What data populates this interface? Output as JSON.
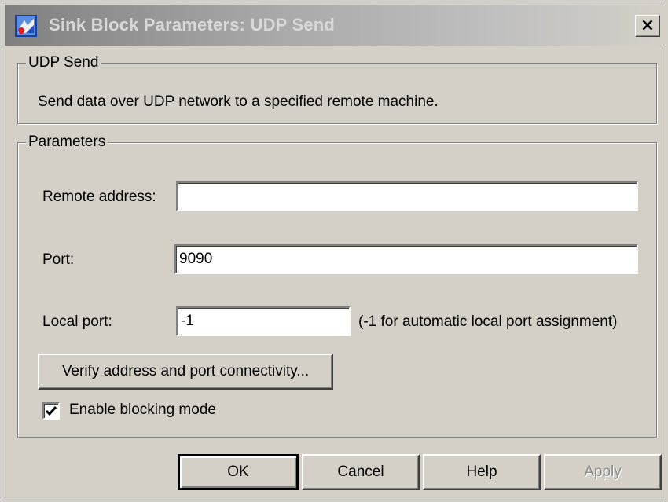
{
  "window": {
    "title": "Sink Block Parameters: UDP Send",
    "close_label": "×"
  },
  "description_group": {
    "legend": "UDP Send",
    "text": "Send data over UDP network to a specified remote machine."
  },
  "parameters_group": {
    "legend": "Parameters",
    "remote_address": {
      "label": "Remote address:",
      "value": ""
    },
    "port": {
      "label": "Port:",
      "value": "9090"
    },
    "local_port": {
      "label": "Local port:",
      "value": "-1",
      "hint": "(-1 for automatic local port assignment)"
    },
    "verify_button_label": "Verify address and port connectivity...",
    "blocking_mode": {
      "label": "Enable blocking mode",
      "checked": true
    }
  },
  "buttons": {
    "ok": "OK",
    "cancel": "Cancel",
    "help": "Help",
    "apply": "Apply"
  },
  "icons": {
    "app": "simulink-block-icon",
    "close": "close-icon",
    "check": "checkmark-icon"
  },
  "colors": {
    "face": "#d4d0c8",
    "title_gradient_start": "#808080",
    "title_text": "#d8d8d8"
  }
}
